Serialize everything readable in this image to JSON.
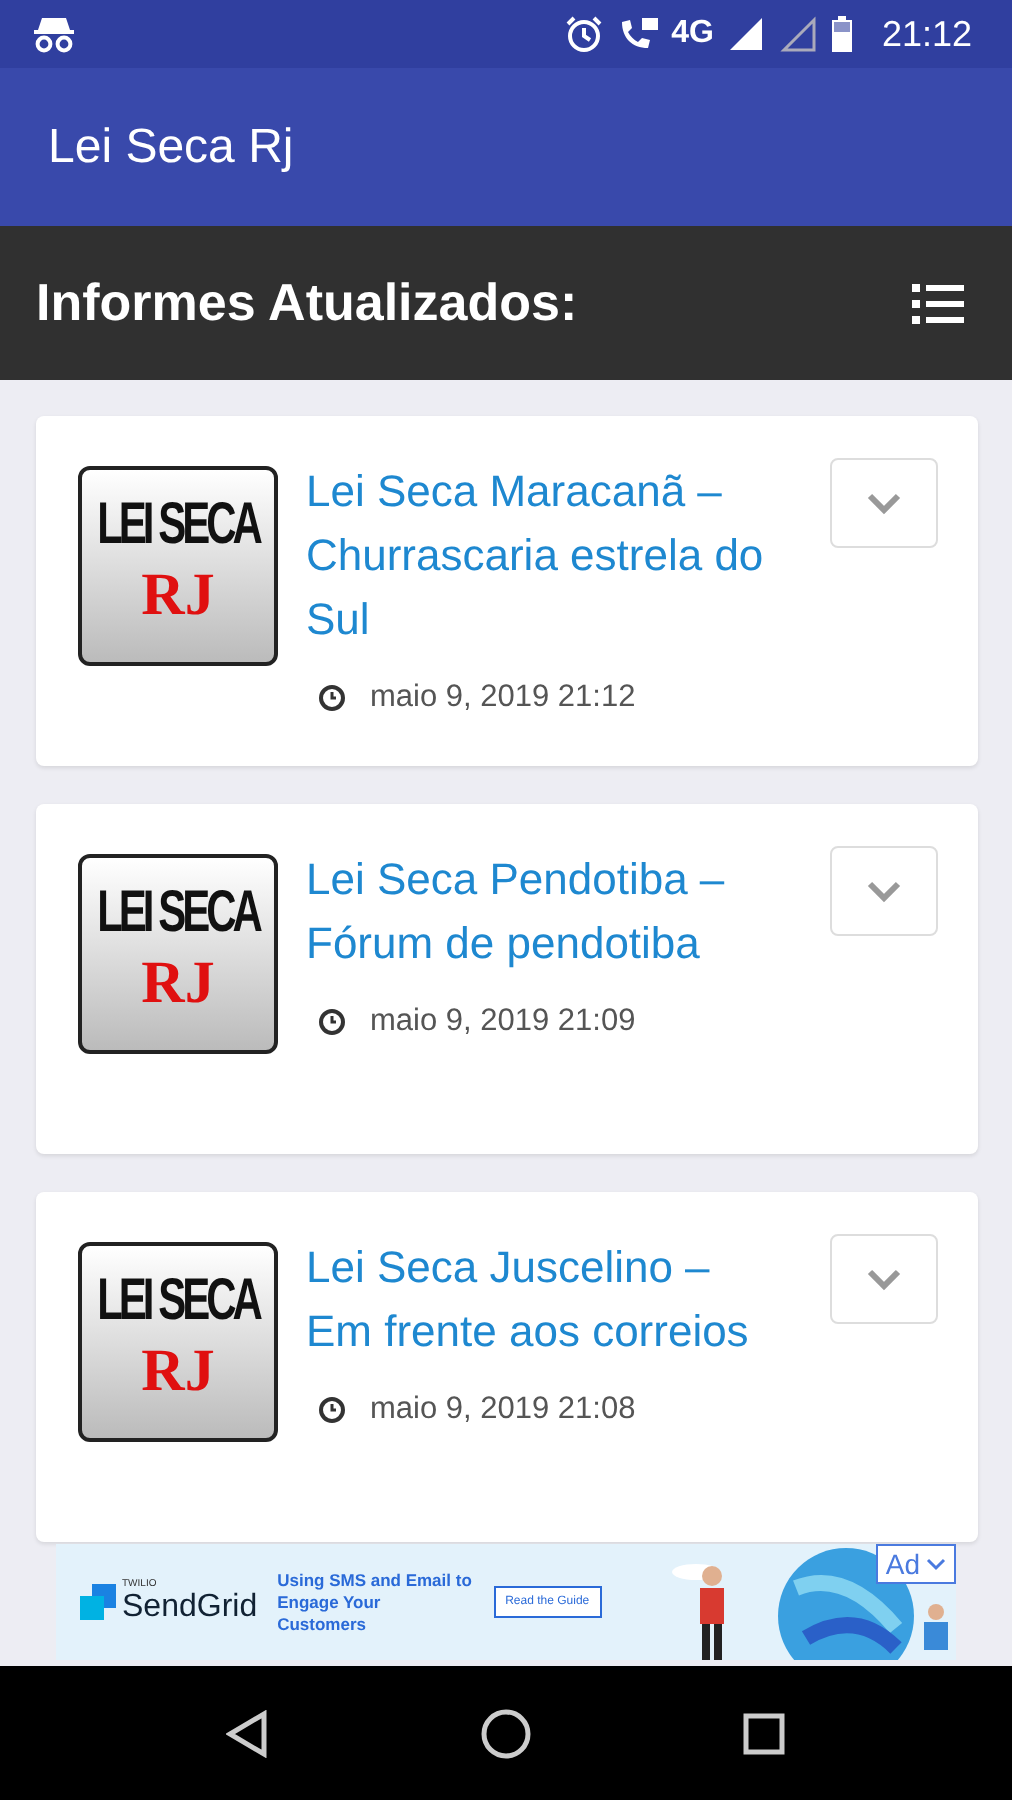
{
  "status_bar": {
    "network": "4G",
    "time": "21:12"
  },
  "app_bar": {
    "title": "Lei Seca Rj"
  },
  "section": {
    "title": "Informes Atualizados:"
  },
  "posts": [
    {
      "title": "Lei Seca Maracanã – Churrascaria estrela do Sul",
      "date": "maio 9, 2019 21:12",
      "thumb_top": "LEI SECA",
      "thumb_bottom": "RJ"
    },
    {
      "title": "Lei Seca Pendotiba – Fórum de pendotiba",
      "date": "maio 9, 2019 21:09",
      "thumb_top": "LEI SECA",
      "thumb_bottom": "RJ"
    },
    {
      "title": "Lei Seca Juscelino – Em frente aos correios",
      "date": "maio 9, 2019 21:08",
      "thumb_top": "LEI SECA",
      "thumb_bottom": "RJ"
    }
  ],
  "ad": {
    "brand_small": "TWILIO",
    "brand": "SendGrid",
    "text": "Using SMS and Email to Engage Your Customers",
    "button": "Read the Guide",
    "badge": "Ad"
  }
}
